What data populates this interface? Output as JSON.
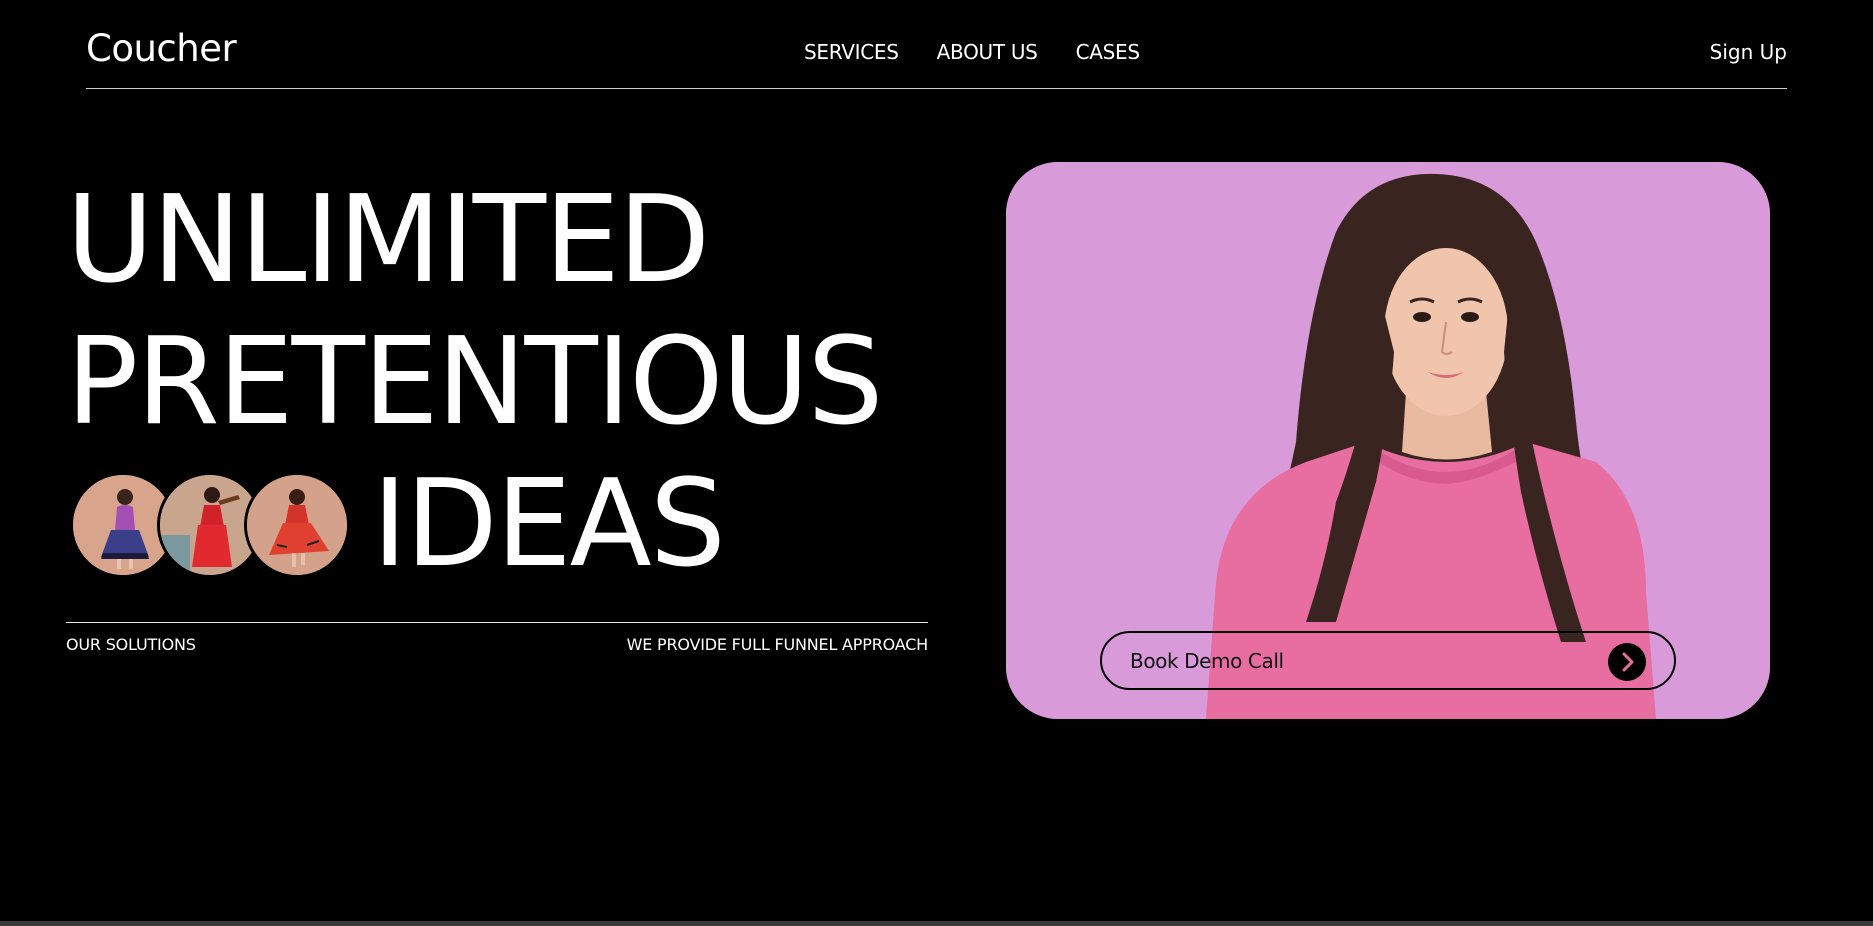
{
  "header": {
    "logo": "Coucher",
    "nav": [
      {
        "label": "SERVICES"
      },
      {
        "label": "ABOUT US"
      },
      {
        "label": "CASES"
      }
    ],
    "signup_label": "Sign Up"
  },
  "hero": {
    "headline": [
      "UNLIMITED",
      "PRETENTIOUS",
      "IDEAS"
    ],
    "left_caption": "OUR SOLUTIONS",
    "right_caption": "WE PROVIDE FULL FUNNEL APPROACH",
    "cta_label": "Book Demo Call",
    "avatars": [
      {
        "icon": "woman-purple-skirt-photo"
      },
      {
        "icon": "woman-red-dress-violin-photo"
      },
      {
        "icon": "woman-red-dress-dancing-photo"
      }
    ]
  },
  "colors": {
    "background": "#000000",
    "text": "#ffffff",
    "card": "#d89ad9",
    "sweater": "#e86da0"
  }
}
